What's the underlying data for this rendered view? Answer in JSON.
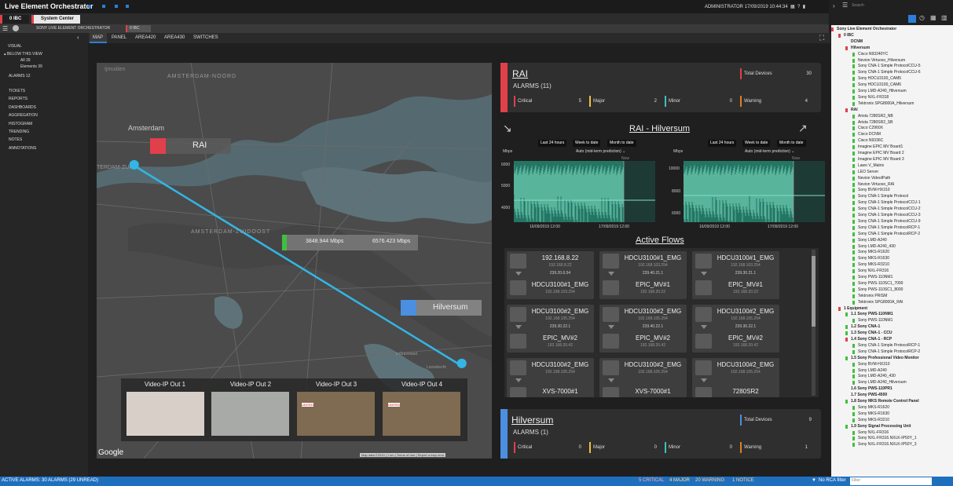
{
  "app": {
    "title": "Live Element Orchestrator",
    "user": "ADMINISTRATOR",
    "datetime": "17/09/2019 10:44:34"
  },
  "window_tabs": [
    "0 IBC",
    "System Center"
  ],
  "crumbs": [
    "SONY LIVE ELEMENT ORCHESTRATOR",
    "0 IBC"
  ],
  "left_nav": {
    "visual": "VISUAL",
    "below": "BELOW THIS VIEW",
    "all": "All 39",
    "elements": "Elements 39",
    "alarms": "ALARMS 12",
    "items": [
      "TICKETS",
      "REPORTS",
      "DASHBOARDS",
      "AGGREGATION",
      "HISTOGRAM",
      "TRENDING",
      "NOTES",
      "ANNOTATIONS"
    ]
  },
  "main_tabs": [
    "MAP",
    "PANEL",
    "AREA420",
    "AREA430",
    "SWITCHES"
  ],
  "map": {
    "places": [
      "AMSTERDAM-NOORD",
      "Amsterdam",
      "TERDAM-ZUID",
      "AMSTERDAM-ZUIDOOST",
      "'s-Graveland",
      "Ijmuiden",
      "Hilversum",
      "Loosdrecht"
    ],
    "sites": [
      "RAI",
      "Hilversum"
    ],
    "link_in": "3848.944 Mbps",
    "link_out": "6576.423 Mbps",
    "google": "Google",
    "footer": [
      "Map data ©2019",
      "1 km",
      "Terms of Use",
      "Report a map error"
    ],
    "video_outs": [
      "Video-IP Out 1",
      "Video-IP Out 2",
      "Video-IP Out 3",
      "Video-IP Out 4"
    ],
    "video_brand": "UNITED"
  },
  "rai_card": {
    "title": "RAI",
    "alarms": "ALARMS (11)",
    "total_label": "Total Devices",
    "total": "30",
    "stats": [
      {
        "label": "Critical",
        "value": "5",
        "color": "#e0404a"
      },
      {
        "label": "Major",
        "value": "2",
        "color": "#f0c040"
      },
      {
        "label": "Minor",
        "value": "0",
        "color": "#40c0c0"
      },
      {
        "label": "Warning",
        "value": "4",
        "color": "#e08020"
      }
    ]
  },
  "trend": {
    "title": "RAI - Hilversum",
    "chips": [
      "Last 24 hours",
      "Week to date",
      "Month to date"
    ],
    "mode": "Auto (mid-term prediction)",
    "unit": "Mbps",
    "now": "Now",
    "left_ticks": [
      "6000",
      "5000",
      "4000"
    ],
    "right_ticks": [
      "10000",
      "8000",
      "6000"
    ],
    "x_ticks": [
      "16/09/2019 12:00",
      "17/09/2019 12:00"
    ]
  },
  "flows_title": "Active Flows",
  "flows": [
    {
      "a": "192.168.8.22",
      "a_ip": "192.168.8.22",
      "mc": "239.20.6.54",
      "b": "HDCU3100#1_EMG",
      "b_ip": "192.168.103.254"
    },
    {
      "a": "HDCU3100#1_EMG",
      "a_ip": "192.168.103.254",
      "mc": "239.40.21.1",
      "b": "EPIC_MV#1",
      "b_ip": "192.168.20.22"
    },
    {
      "a": "HDCU3100#1_EMG",
      "a_ip": "192.168.103.254",
      "mc": "239.30.21.1",
      "b": "EPIC_MV#1",
      "b_ip": "192.168.20.22"
    },
    {
      "a": "HDCU3100#2_EMG",
      "a_ip": "192.168.105.254",
      "mc": "239.30.22.1",
      "b": "EPIC_MV#2",
      "b_ip": "192.168.20.42"
    },
    {
      "a": "HDCU3100#2_EMG",
      "a_ip": "192.168.105.254",
      "mc": "239.40.22.1",
      "b": "EPIC_MV#2",
      "b_ip": "192.168.20.42"
    },
    {
      "a": "HDCU3100#2_EMG",
      "a_ip": "192.168.105.254",
      "mc": "239.30.22.1",
      "b": "EPIC_MV#2",
      "b_ip": "192.168.20.42"
    },
    {
      "a": "HDCU3100#2_EMG",
      "a_ip": "192.168.105.254",
      "mc": "",
      "b": "XVS-7000#1",
      "b_ip": ""
    },
    {
      "a": "HDCU3100#2_EMG",
      "a_ip": "192.168.105.254",
      "mc": "",
      "b": "XVS-7000#1",
      "b_ip": ""
    },
    {
      "a": "HDCU3100#2_EMG",
      "a_ip": "192.168.105.254",
      "mc": "",
      "b": "7280SR2",
      "b_ip": ""
    }
  ],
  "hil_card": {
    "title": "Hilversum",
    "alarms": "ALARMS (1)",
    "total_label": "Total Devices",
    "total": "9",
    "stats": [
      {
        "label": "Critical",
        "value": "0",
        "color": "#e0404a"
      },
      {
        "label": "Major",
        "value": "0",
        "color": "#f0c040"
      },
      {
        "label": "Minor",
        "value": "0",
        "color": "#40c0c0"
      },
      {
        "label": "Warning",
        "value": "1",
        "color": "#e08020"
      }
    ]
  },
  "search_placeholder": "Search",
  "tree": [
    {
      "t": "Sony Live Element Orchestrator",
      "l": 0,
      "b": 1,
      "c": "#e0404a"
    },
    {
      "t": "0 IBC",
      "l": 1,
      "b": 1,
      "c": "#e0404a"
    },
    {
      "t": "DCNM",
      "l": 2,
      "b": 1,
      "c": ""
    },
    {
      "t": "Hilversum",
      "l": 2,
      "b": 1,
      "c": "#e0404a"
    },
    {
      "t": "Cisco N93240YC",
      "l": 3,
      "c": "#40c040"
    },
    {
      "t": "Nevion Virtuoso_Hilversum",
      "l": 3,
      "c": "#40c040"
    },
    {
      "t": "Sony CNA-1 Simple ProtocolCCU-5",
      "l": 3,
      "c": "#40c040"
    },
    {
      "t": "Sony CNA-1 Simple ProtocolCCU-6",
      "l": 3,
      "c": "#40c040"
    },
    {
      "t": "Sony HDCU3100_CAM5",
      "l": 3,
      "c": "#40c040"
    },
    {
      "t": "Sony HDCU3100_CAM6",
      "l": 3,
      "c": "#40c040"
    },
    {
      "t": "Sony LMD-A240_Hilversum",
      "l": 3,
      "c": "#40c040"
    },
    {
      "t": "Sony NXL-FR318",
      "l": 3,
      "c": "#40c040"
    },
    {
      "t": "Tektronix SPG8000A_Hilversum",
      "l": 3,
      "c": "#40c040"
    },
    {
      "t": "RAI",
      "l": 2,
      "b": 1,
      "c": "#e0404a"
    },
    {
      "t": "Arista 7280SR2_NB",
      "l": 3,
      "c": "#40c040"
    },
    {
      "t": "Arista 7280SR2_SB",
      "l": 3,
      "c": "#40c040"
    },
    {
      "t": "Cisco C2960X",
      "l": 3,
      "c": "#40c040"
    },
    {
      "t": "Cisco DCNM",
      "l": 3,
      "c": "#40c040"
    },
    {
      "t": "Cisco N9336C",
      "l": 3,
      "c": "#40c040"
    },
    {
      "t": "Imagine EPIC MV Board1",
      "l": 3,
      "c": "#40c040"
    },
    {
      "t": "Imagine EPIC MV Board 2",
      "l": 3,
      "c": "#40c040"
    },
    {
      "t": "Imagine EPIC MV Board 3",
      "l": 3,
      "c": "#40c040"
    },
    {
      "t": "Lawo V_Matrix",
      "l": 3,
      "c": "#40c040"
    },
    {
      "t": "LEO Server",
      "l": 3,
      "c": "#40c040"
    },
    {
      "t": "Nevion VideoIPath",
      "l": 3,
      "c": "#40c040"
    },
    {
      "t": "Nevion Virtuoso_RAI",
      "l": 3,
      "c": "#40c040"
    },
    {
      "t": "Sony BVM-HX310",
      "l": 3,
      "c": "#40c040"
    },
    {
      "t": "Sony CNA-1 Simple Protocol",
      "l": 3,
      "c": "#40c040"
    },
    {
      "t": "Sony CNA-1 Simple ProtocolCCU-1",
      "l": 3,
      "c": "#40c040"
    },
    {
      "t": "Sony CNA-1 Simple ProtocolCCU-2",
      "l": 3,
      "c": "#40c040"
    },
    {
      "t": "Sony CNA-1 Simple ProtocolCCU-3",
      "l": 3,
      "c": "#40c040"
    },
    {
      "t": "Sony CNA-1 Simple ProtocolCCU-9",
      "l": 3,
      "c": "#40c040"
    },
    {
      "t": "Sony CNA-1 Simple ProtocolRCP-1",
      "l": 3,
      "c": "#40c040"
    },
    {
      "t": "Sony CNA-1 Simple ProtocolRCP-2",
      "l": 3,
      "c": "#40c040"
    },
    {
      "t": "Sony LMD-A240",
      "l": 3,
      "c": "#40c040"
    },
    {
      "t": "Sony LMD-A240_430",
      "l": 3,
      "c": "#40c040"
    },
    {
      "t": "Sony MKS-R1620",
      "l": 3,
      "c": "#40c040"
    },
    {
      "t": "Sony MKS-R1630",
      "l": 3,
      "c": "#40c040"
    },
    {
      "t": "Sony MKS-R3210",
      "l": 3,
      "c": "#40c040"
    },
    {
      "t": "Sony NXL-FR316",
      "l": 3,
      "c": "#40c040"
    },
    {
      "t": "Sony PWS-110NM1",
      "l": 3,
      "c": "#40c040"
    },
    {
      "t": "Sony PWS-110SC1_7000",
      "l": 3,
      "c": "#40c040"
    },
    {
      "t": "Sony PWS-110SC1_8000",
      "l": 3,
      "c": "#40c040"
    },
    {
      "t": "Tektronix PRISM",
      "l": 3,
      "c": "#40c040"
    },
    {
      "t": "Tektronix SPG8000A_RAI",
      "l": 3,
      "c": "#40c040"
    },
    {
      "t": "1 Equipment",
      "l": 1,
      "b": 1,
      "c": "#e0404a"
    },
    {
      "t": "1.1 Sony PWS-110NM1",
      "l": 2,
      "b": 1,
      "c": "#40c040"
    },
    {
      "t": "Sony PWS-110NM1",
      "l": 3,
      "c": "#40c040"
    },
    {
      "t": "1.2 Sony CNA-1",
      "l": 2,
      "b": 1,
      "c": "#40c040"
    },
    {
      "t": "1.3 Sony CNA-1 - CCU",
      "l": 2,
      "b": 1,
      "c": "#40c040"
    },
    {
      "t": "1.4 Sony CNA-1 - RCP",
      "l": 2,
      "b": 1,
      "c": "#e0404a"
    },
    {
      "t": "Sony CNA-1 Simple ProtocolRCP-1",
      "l": 3,
      "c": "#40c040"
    },
    {
      "t": "Sony CNA-1 Simple ProtocolRCP-2",
      "l": 3,
      "c": "#40c040"
    },
    {
      "t": "1.5 Sony Professional Video Monitor",
      "l": 2,
      "b": 1,
      "c": "#40c040"
    },
    {
      "t": "Sony BVM-HX310",
      "l": 3,
      "c": "#40c040"
    },
    {
      "t": "Sony LMD-A240",
      "l": 3,
      "c": "#40c040"
    },
    {
      "t": "Sony LMD-A240_430",
      "l": 3,
      "c": "#40c040"
    },
    {
      "t": "Sony LMD-A240_Hilversum",
      "l": 3,
      "c": "#40c040"
    },
    {
      "t": "1.6 Sony PWS-110PR1",
      "l": 2,
      "b": 1,
      "c": ""
    },
    {
      "t": "1.7 Sony PWS-4500",
      "l": 2,
      "b": 1,
      "c": ""
    },
    {
      "t": "1.8 Sony MKS Remote Control Panel",
      "l": 2,
      "b": 1,
      "c": "#40c040"
    },
    {
      "t": "Sony MKS-R1620",
      "l": 3,
      "c": "#40c040"
    },
    {
      "t": "Sony MKS-R1630",
      "l": 3,
      "c": "#40c040"
    },
    {
      "t": "Sony MKS-R3210",
      "l": 3,
      "c": "#40c040"
    },
    {
      "t": "1.9 Sony Signal Processing Unit",
      "l": 2,
      "b": 1,
      "c": "#40c040"
    },
    {
      "t": "Sony NXL-FR316",
      "l": 3,
      "c": "#40c040"
    },
    {
      "t": "Sony NXL-FR316.NXLK-IP50Y_1",
      "l": 3,
      "c": "#40c040"
    },
    {
      "t": "Sony NXL-FR316.NXLK-IP50Y_3",
      "l": 3,
      "c": "#40c040"
    }
  ],
  "status": {
    "active": "ACTIVE ALARMS: 30 ALARMS (29 UNREAD)",
    "critical": "5 CRITICAL",
    "major": "4 MAJOR",
    "warning": "20 WARNING",
    "notice": "1 NOTICE",
    "filter": "No RCA filter",
    "filter_ph": "Filter"
  },
  "colors": {
    "accent": "#2b7fd8",
    "critical": "#e0404a",
    "rai": "#e0404a",
    "hil": "#4a8fe0",
    "link": "#33b5e5",
    "trend": "#2aa58a"
  }
}
